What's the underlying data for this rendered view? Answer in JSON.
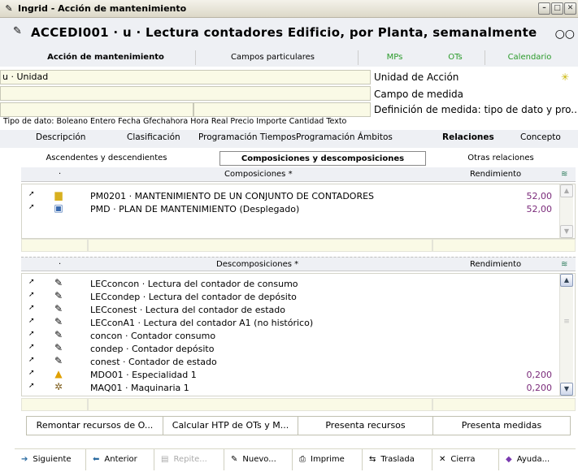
{
  "window": {
    "title": "Ingrid - Acción de mantenimiento"
  },
  "header": {
    "code": "ACCEDI001 · u · Lectura contadores Edificio, por Planta, semanalmente"
  },
  "main_tabs": [
    "Acción de mantenimiento",
    "Campos particulares",
    "MPs",
    "OTs",
    "Calendario"
  ],
  "fields": {
    "unidad_value": "u · Unidad",
    "unidad_label": "Unidad de Acción",
    "campo_label": "Campo de medida",
    "definicion_label": "Definición de medida: tipo de dato y pro...",
    "tipo_dato": "Tipo de dato: Boleano Entero Fecha Gfechahora Hora Real Precio Importe Cantidad Texto"
  },
  "sub_tabs": [
    "Descripción",
    "Clasificación",
    "Programación Tiempos",
    "Programación Ámbitos",
    "Relaciones",
    "Concepto"
  ],
  "relation_tabs": [
    "Ascendentes y descendientes",
    "Composiciones y descomposiciones",
    "Otras relaciones"
  ],
  "composiciones": {
    "dot": "·",
    "header": "Composiciones *",
    "rend_header": "Rendimiento",
    "rows": [
      {
        "text": "PM0201 · MANTENIMIENTO DE UN CONJUNTO DE CONTADORES",
        "value": "52,00",
        "icon": "folder-icon"
      },
      {
        "text": "PMD · PLAN DE MANTENIMIENTO (Desplegado)",
        "value": "52,00",
        "icon": "plan-icon"
      }
    ]
  },
  "descomposiciones": {
    "dot": "·",
    "header": "Descomposiciones *",
    "rend_header": "Rendimiento",
    "rows": [
      {
        "text": "LECconcon · Lectura del contador de consumo",
        "value": ""
      },
      {
        "text": "LECcondep · Lectura del contador de depósito",
        "value": ""
      },
      {
        "text": "LECconest · Lectura del contador de estado",
        "value": ""
      },
      {
        "text": "LECconA1 · Lectura del contador A1 (no histórico)",
        "value": ""
      },
      {
        "text": "concon · Contador consumo",
        "value": ""
      },
      {
        "text": "condep · Contador depósito",
        "value": ""
      },
      {
        "text": "conest · Contador de estado",
        "value": ""
      },
      {
        "text": "MDO01 · Especialidad 1",
        "value": "0,200"
      },
      {
        "text": "MAQ01 · Maquinaria 1",
        "value": "0,200"
      }
    ]
  },
  "bottom_buttons": [
    "Remontar recursos de O...",
    "Calcular HTP de OTs y M...",
    "Presenta recursos",
    "Presenta medidas"
  ],
  "toolbar": [
    "Siguiente",
    "Anterior",
    "Repite...",
    "Nuevo...",
    "Imprime",
    "Traslada",
    "Cierra",
    "Ayuda..."
  ],
  "colors": {
    "accent_green": "#2a9a2a",
    "value_purple": "#7a2a7a",
    "field_yellow": "#fafae6"
  }
}
